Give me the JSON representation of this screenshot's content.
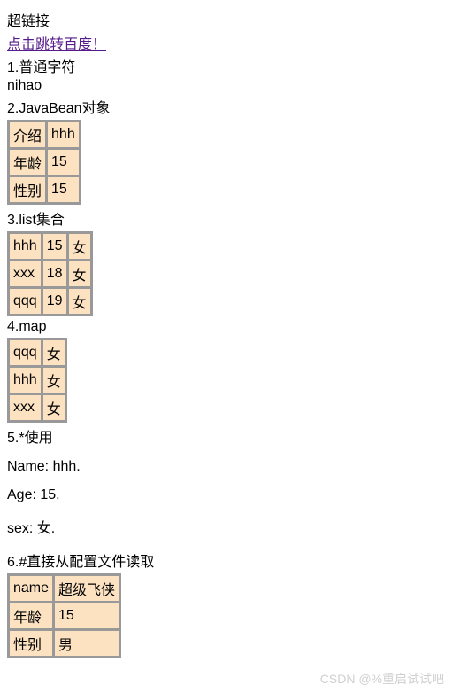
{
  "heading": "超链接",
  "link_text": "点击跳转百度！",
  "section1_label": "1.普通字符",
  "section1_value": "nihao",
  "section2_label": "2.JavaBean对象",
  "javabean": {
    "rows": [
      {
        "k": "介绍",
        "v": "hhh"
      },
      {
        "k": "年龄",
        "v": "15"
      },
      {
        "k": "性别",
        "v": "15"
      }
    ]
  },
  "section3_label": "3.list集合",
  "list": {
    "rows": [
      {
        "c0": "hhh",
        "c1": "15",
        "c2": "女"
      },
      {
        "c0": "xxx",
        "c1": "18",
        "c2": "女"
      },
      {
        "c0": "qqq",
        "c1": "19",
        "c2": "女"
      }
    ]
  },
  "section4_label": "4.map",
  "map": {
    "rows": [
      {
        "k": "qqq",
        "v": "女"
      },
      {
        "k": "hhh",
        "v": "女"
      },
      {
        "k": "xxx",
        "v": "女"
      }
    ]
  },
  "section5_label": "5.*使用",
  "star": {
    "name_line": "Name: hhh.",
    "age_line": "Age: 15.",
    "sex_line": "sex: 女."
  },
  "section6_label": "6.#直接从配置文件读取",
  "config": {
    "rows": [
      {
        "k": "name",
        "v": "超级飞侠"
      },
      {
        "k": "年龄",
        "v": "15"
      },
      {
        "k": "性别",
        "v": "男"
      }
    ]
  },
  "watermark": "CSDN @%重启试试吧"
}
